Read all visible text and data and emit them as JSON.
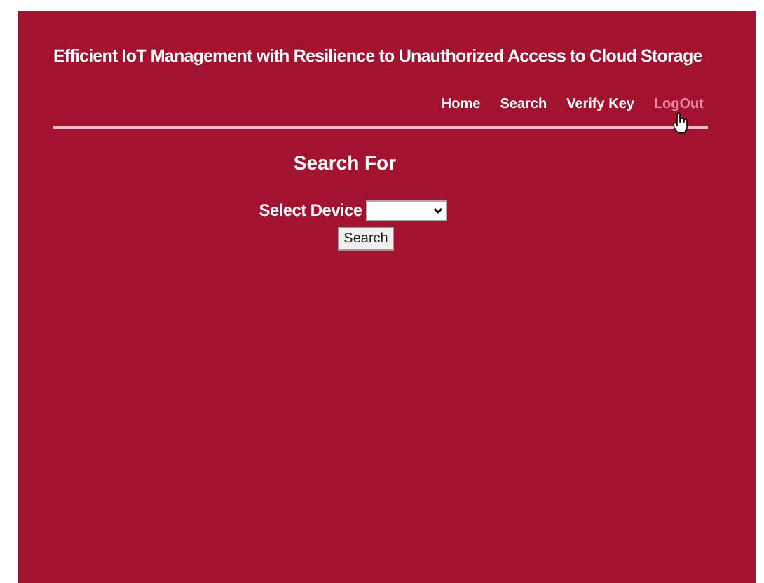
{
  "header": {
    "title": "Efficient IoT Management with Resilience to Unauthorized Access to Cloud Storage"
  },
  "nav": [
    {
      "label": "Home",
      "selected": false
    },
    {
      "label": "Search",
      "selected": false
    },
    {
      "label": "Verify Key",
      "selected": false
    },
    {
      "label": "LogOut",
      "selected": true
    }
  ],
  "form": {
    "heading": "Search For",
    "label": "Select Device",
    "button": "Search"
  }
}
